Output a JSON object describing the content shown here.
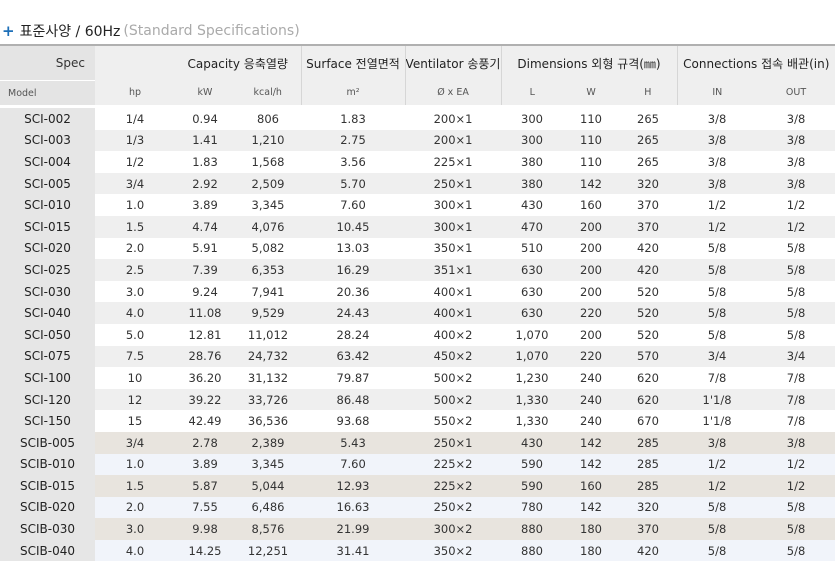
{
  "title": {
    "prefix": "+",
    "main": "표준사양 / 60Hz",
    "sub": "(Standard Specifications)"
  },
  "headers": {
    "spec": "Spec",
    "model": "Model",
    "capacity": "Capacity 응축열량",
    "surface": "Surface 전열면적",
    "ventilator": "Ventilator 송풍기",
    "dimensions": "Dimensions 외형 규격(㎜)",
    "connections": "Connections 접속 배관(in)",
    "hp": "hp",
    "kw": "kW",
    "kcal": "kcal/h",
    "m2": "m²",
    "fan": "Ø x EA",
    "L": "L",
    "W": "W",
    "H": "H",
    "in": "IN",
    "out": "OUT"
  },
  "rows": [
    [
      "SCI-002",
      "1/4",
      "0.94",
      "806",
      "1.83",
      "200×1",
      "300",
      "110",
      "265",
      "3/8",
      "3/8"
    ],
    [
      "SCI-003",
      "1/3",
      "1.41",
      "1,210",
      "2.75",
      "200×1",
      "300",
      "110",
      "265",
      "3/8",
      "3/8"
    ],
    [
      "SCI-004",
      "1/2",
      "1.83",
      "1,568",
      "3.56",
      "225×1",
      "380",
      "110",
      "265",
      "3/8",
      "3/8"
    ],
    [
      "SCI-005",
      "3/4",
      "2.92",
      "2,509",
      "5.70",
      "250×1",
      "380",
      "142",
      "320",
      "3/8",
      "3/8"
    ],
    [
      "SCI-010",
      "1.0",
      "3.89",
      "3,345",
      "7.60",
      "300×1",
      "430",
      "160",
      "370",
      "1/2",
      "1/2"
    ],
    [
      "SCI-015",
      "1.5",
      "4.74",
      "4,076",
      "10.45",
      "300×1",
      "470",
      "200",
      "370",
      "1/2",
      "1/2"
    ],
    [
      "SCI-020",
      "2.0",
      "5.91",
      "5,082",
      "13.03",
      "350×1",
      "510",
      "200",
      "420",
      "5/8",
      "5/8"
    ],
    [
      "SCI-025",
      "2.5",
      "7.39",
      "6,353",
      "16.29",
      "351×1",
      "630",
      "200",
      "420",
      "5/8",
      "5/8"
    ],
    [
      "SCI-030",
      "3.0",
      "9.24",
      "7,941",
      "20.36",
      "400×1",
      "630",
      "200",
      "520",
      "5/8",
      "5/8"
    ],
    [
      "SCI-040",
      "4.0",
      "11.08",
      "9,529",
      "24.43",
      "400×1",
      "630",
      "220",
      "520",
      "5/8",
      "5/8"
    ],
    [
      "SCI-050",
      "5.0",
      "12.81",
      "11,012",
      "28.24",
      "400×2",
      "1,070",
      "200",
      "520",
      "5/8",
      "5/8"
    ],
    [
      "SCI-075",
      "7.5",
      "28.76",
      "24,732",
      "63.42",
      "450×2",
      "1,070",
      "220",
      "570",
      "3/4",
      "3/4"
    ],
    [
      "SCI-100",
      "10",
      "36.20",
      "31,132",
      "79.87",
      "500×2",
      "1,230",
      "240",
      "620",
      "7/8",
      "7/8"
    ],
    [
      "SCI-120",
      "12",
      "39.22",
      "33,726",
      "86.48",
      "500×2",
      "1,330",
      "240",
      "620",
      "1'1/8",
      "7/8"
    ],
    [
      "SCI-150",
      "15",
      "42.49",
      "36,536",
      "93.68",
      "550×2",
      "1,330",
      "240",
      "670",
      "1'1/8",
      "7/8"
    ],
    [
      "SCIB-005",
      "3/4",
      "2.78",
      "2,389",
      "5.43",
      "250×1",
      "430",
      "142",
      "285",
      "3/8",
      "3/8"
    ],
    [
      "SCIB-010",
      "1.0",
      "3.89",
      "3,345",
      "7.60",
      "225×2",
      "590",
      "142",
      "285",
      "1/2",
      "1/2"
    ],
    [
      "SCIB-015",
      "1.5",
      "5.87",
      "5,044",
      "12.93",
      "225×2",
      "590",
      "160",
      "285",
      "1/2",
      "1/2"
    ],
    [
      "SCIB-020",
      "2.0",
      "7.55",
      "6,486",
      "16.63",
      "250×2",
      "780",
      "142",
      "320",
      "5/8",
      "5/8"
    ],
    [
      "SCIB-030",
      "3.0",
      "9.98",
      "8,576",
      "21.99",
      "300×2",
      "880",
      "180",
      "370",
      "5/8",
      "5/8"
    ],
    [
      "SCIB-040",
      "4.0",
      "14.25",
      "12,251",
      "31.41",
      "350×2",
      "880",
      "180",
      "420",
      "5/8",
      "5/8"
    ]
  ],
  "b_series_start": 15
}
